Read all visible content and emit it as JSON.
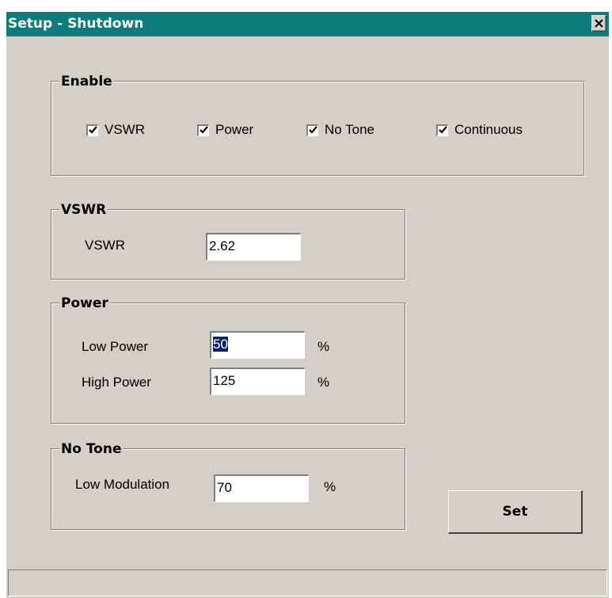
{
  "window": {
    "title": "Setup - Shutdown",
    "close_icon": "close-icon"
  },
  "enable_group": {
    "legend": "Enable",
    "checkboxes": [
      {
        "label": "VSWR",
        "checked": true
      },
      {
        "label": "Power",
        "checked": true
      },
      {
        "label": "No Tone",
        "checked": true
      },
      {
        "label": "Continuous",
        "checked": true
      }
    ]
  },
  "vswr_group": {
    "legend": "VSWR",
    "label": "VSWR",
    "value": "2.62"
  },
  "power_group": {
    "legend": "Power",
    "low_label": "Low Power",
    "low_value": "50",
    "low_unit": "%",
    "high_label": "High Power",
    "high_value": "125",
    "high_unit": "%"
  },
  "no_tone_group": {
    "legend": "No Tone",
    "label": "Low Modulation",
    "value": "70",
    "unit": "%"
  },
  "set_button": "Set",
  "colors": {
    "titlebar": "#0e7c7b",
    "face": "#d4d0c8",
    "selection": "#0a246a"
  }
}
